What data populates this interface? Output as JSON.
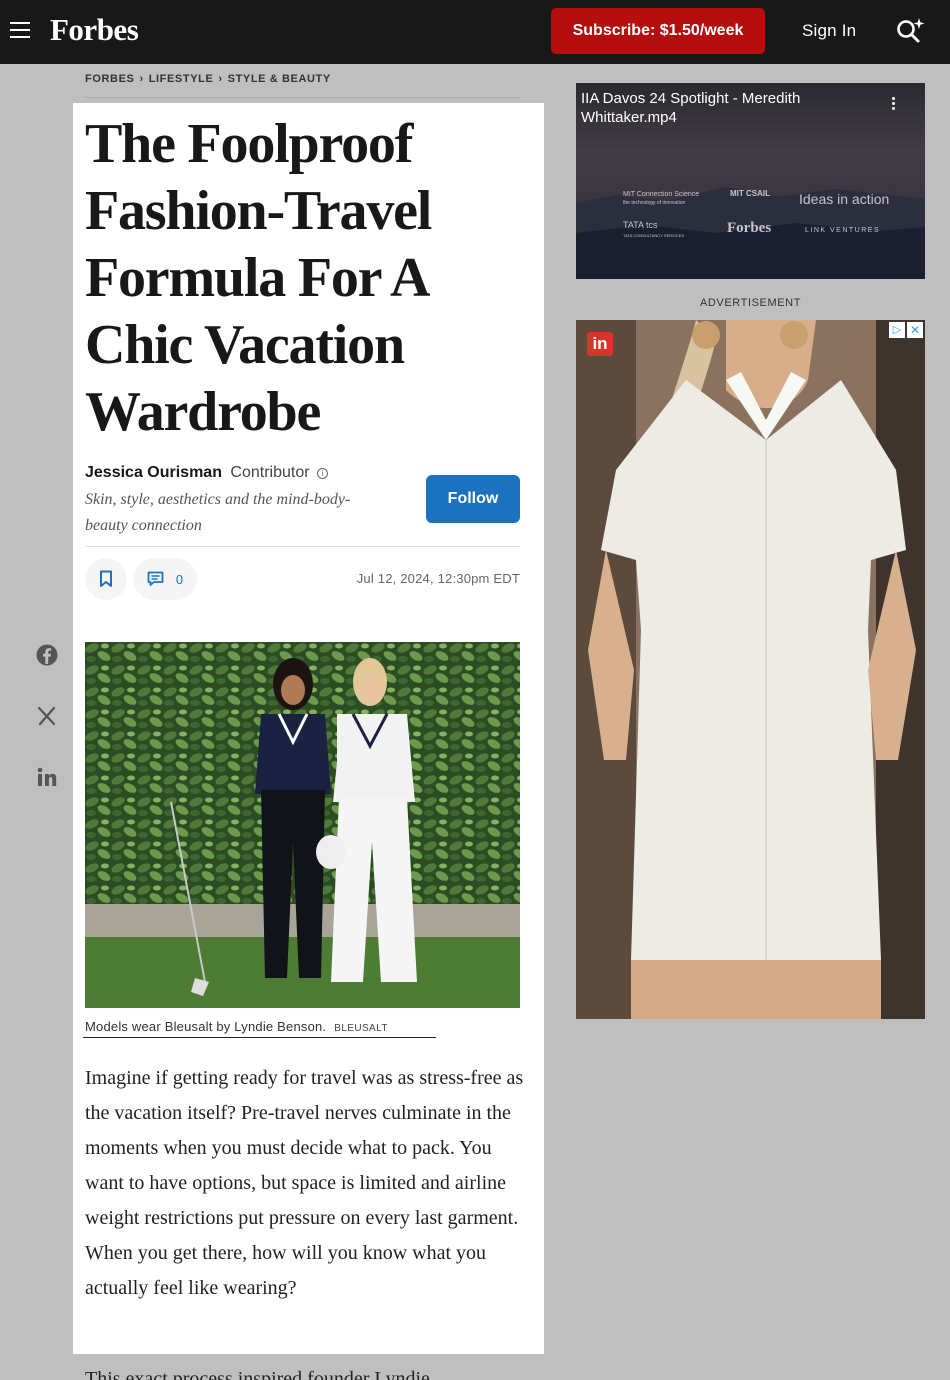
{
  "header": {
    "logo": "Forbes",
    "subscribe_label": "Subscribe: $1.50/week",
    "signin_label": "Sign In"
  },
  "breadcrumb": [
    "FORBES",
    "LIFESTYLE",
    "STYLE & BEAUTY"
  ],
  "article": {
    "headline": "The Foolproof Fashion-Travel Formula For A Chic Vacation Wardrobe",
    "author_name": "Jessica Ourisman",
    "author_role": "Contributor",
    "author_bio": "Skin, style, aesthetics and the mind-body-beauty connection",
    "follow_label": "Follow",
    "comment_count": "0",
    "date": "Jul 12, 2024, 12:30pm EDT",
    "caption": "Models wear Bleusalt by Lyndie Benson.",
    "caption_credit": "BLEUSALT",
    "body_paragraph_1": "Imagine if getting ready for travel was as stress-free as the vacation itself? Pre-travel nerves culminate in the moments when you must decide what to pack. You want to have options, but space is limited and airline weight restrictions put pressure on every last garment. When you get there, how will you know what you actually feel like wearing?",
    "body_paragraph_2": "This exact process inspired founder Lyndie"
  },
  "sidebar": {
    "video_title": "IIA Davos 24 Spotlight - Meredith Whittaker.mp4",
    "video_logos": [
      "MIT Connection Science",
      "the technology of innovation",
      "MIT CSAIL",
      "Ideas in action",
      "TATA tcs",
      "TATA CONSULTANCY SERVICES",
      "Forbes",
      "LINK VENTURES"
    ],
    "ad_label": "ADVERTISEMENT",
    "ad_badge": "in"
  },
  "colors": {
    "brand_red": "#b40e0e",
    "follow_blue": "#1b72be",
    "header_bg": "#181818"
  }
}
